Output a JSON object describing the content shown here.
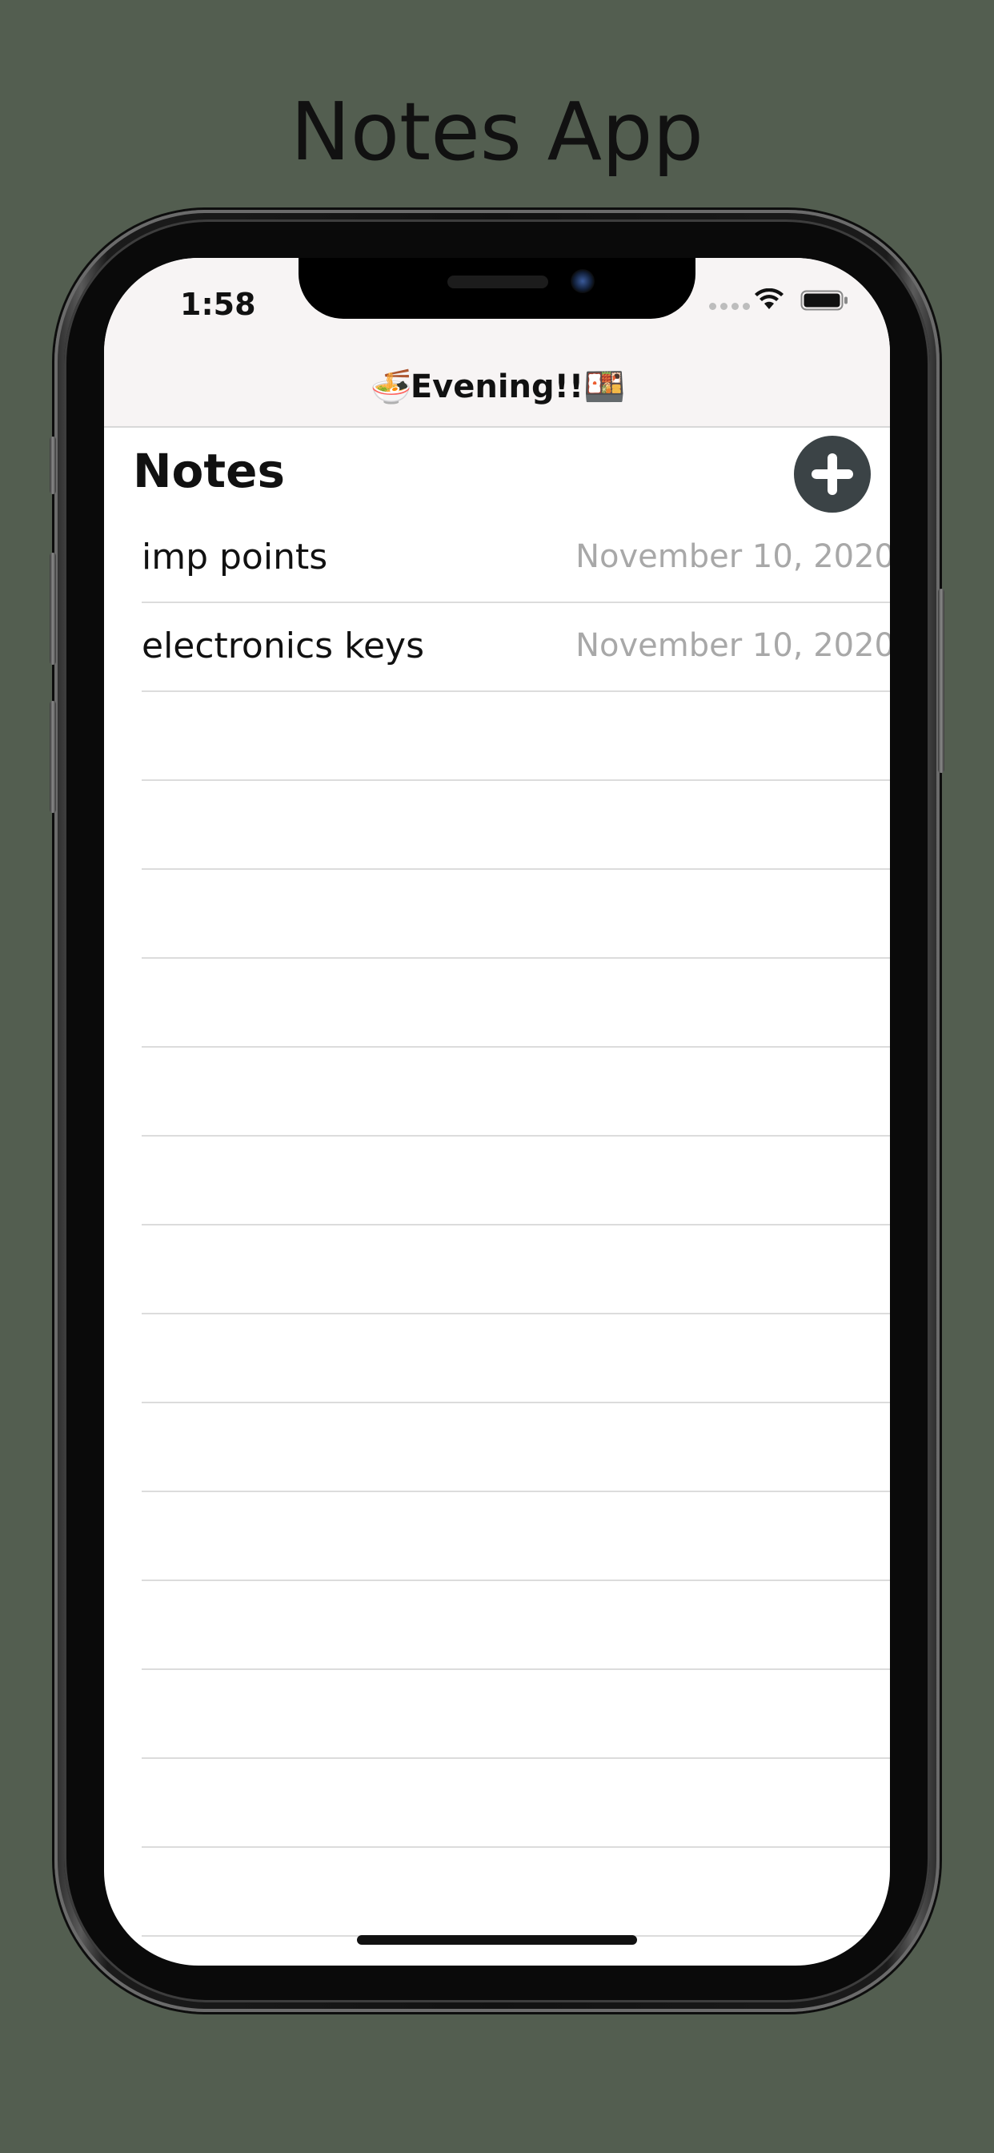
{
  "page": {
    "title": "Notes App"
  },
  "status_bar": {
    "time": "1:58"
  },
  "nav": {
    "left_emoji": "🍜",
    "title": "Evening!!",
    "right_emoji": "🍱"
  },
  "section": {
    "title": "Notes"
  },
  "add_button": {
    "icon": "plus-circle-icon"
  },
  "notes": [
    {
      "title": "imp points",
      "date": "November 10, 2020"
    },
    {
      "title": "electronics keys",
      "date": "November 10, 2020"
    }
  ],
  "colors": {
    "background": "#535e50",
    "nav_bar": "#f7f4f4",
    "add_button": "#3b4346",
    "date_text": "#a8a8a8"
  }
}
